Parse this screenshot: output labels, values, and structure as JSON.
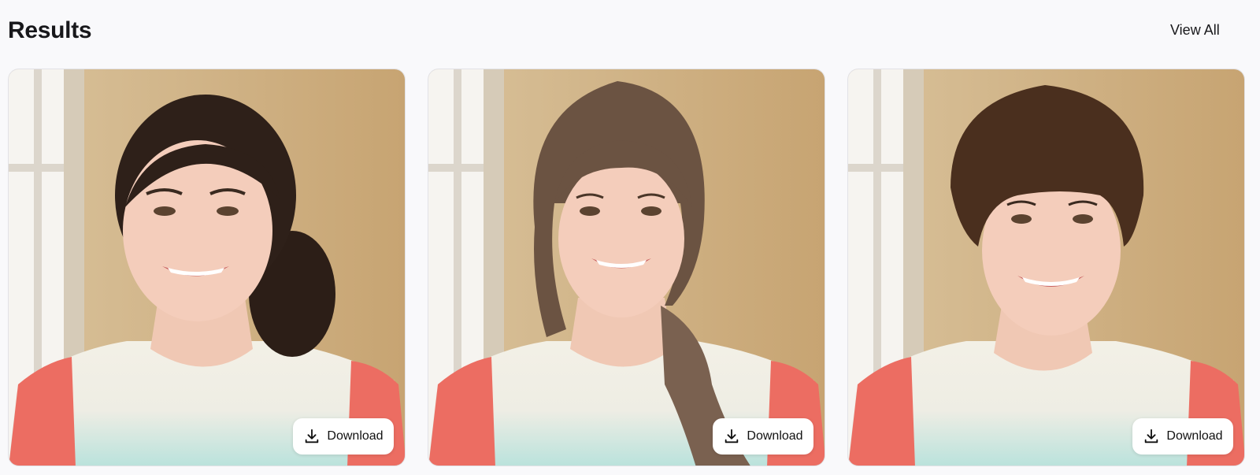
{
  "header": {
    "title": "Results",
    "view_all_label": "View All"
  },
  "results": [
    {
      "download_label": "Download",
      "hair_style": "braided-ponytail"
    },
    {
      "download_label": "Download",
      "hair_style": "long-bangs-braid"
    },
    {
      "download_label": "Download",
      "hair_style": "short-pixie"
    }
  ],
  "icons": {
    "download": "download-icon"
  },
  "colors": {
    "background": "#f9f9fb",
    "wall": "#c9a878",
    "shirt_white": "#f1efe6",
    "shirt_mint": "#bfe3df",
    "sleeve_coral": "#ec6d62"
  }
}
